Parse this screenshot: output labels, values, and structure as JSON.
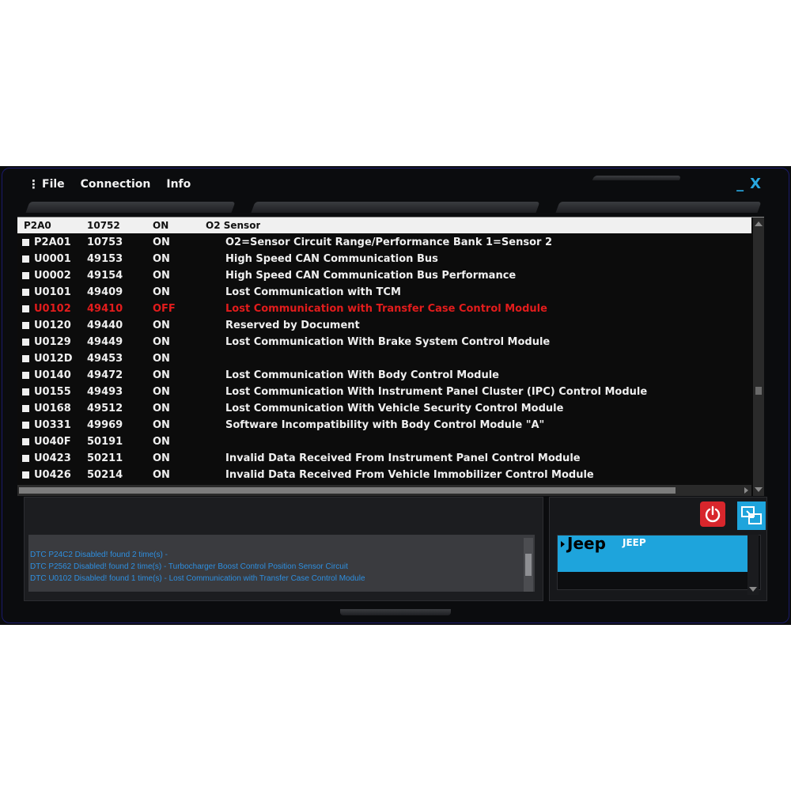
{
  "menu": {
    "grip_icon": "vertical-dots-icon",
    "items": [
      "File",
      "Connection",
      "Info"
    ]
  },
  "window_controls": {
    "minimize": "_",
    "close": "X"
  },
  "table": {
    "header_cells": [
      "P2A0",
      "10752",
      "ON",
      "O2 Sensor"
    ],
    "rows": [
      {
        "code": "P2A01",
        "number": "10753",
        "state": "ON",
        "description": "O2=Sensor Circuit Range/Performance Bank 1=Sensor 2"
      },
      {
        "code": "U0001",
        "number": "49153",
        "state": "ON",
        "description": "High Speed CAN Communication Bus"
      },
      {
        "code": "U0002",
        "number": "49154",
        "state": "ON",
        "description": "High Speed CAN Communication Bus Performance"
      },
      {
        "code": "U0101",
        "number": "49409",
        "state": "ON",
        "description": "Lost Communication with TCM"
      },
      {
        "code": "U0102",
        "number": "49410",
        "state": "OFF",
        "description": "Lost Communication with Transfer Case Control Module"
      },
      {
        "code": "U0120",
        "number": "49440",
        "state": "ON",
        "description": "Reserved by Document"
      },
      {
        "code": "U0129",
        "number": "49449",
        "state": "ON",
        "description": "Lost Communication With Brake System Control Module"
      },
      {
        "code": "U012D",
        "number": "49453",
        "state": "ON",
        "description": ""
      },
      {
        "code": "U0140",
        "number": "49472",
        "state": "ON",
        "description": "Lost Communication With Body Control Module"
      },
      {
        "code": "U0155",
        "number": "49493",
        "state": "ON",
        "description": "Lost Communication With Instrument Panel Cluster (IPC) Control Module"
      },
      {
        "code": "U0168",
        "number": "49512",
        "state": "ON",
        "description": "Lost Communication With Vehicle Security Control Module"
      },
      {
        "code": "U0331",
        "number": "49969",
        "state": "ON",
        "description": "Software Incompatibility with Body Control Module \"A\""
      },
      {
        "code": "U040F",
        "number": "50191",
        "state": "ON",
        "description": ""
      },
      {
        "code": "U0423",
        "number": "50211",
        "state": "ON",
        "description": "Invalid Data Received From Instrument Panel Control Module"
      },
      {
        "code": "U0426",
        "number": "50214",
        "state": "ON",
        "description": "Invalid Data Received From Vehicle Immobilizer Control Module"
      }
    ]
  },
  "log": {
    "lines": [
      "DTC P24C2 Disabled! found 2 time(s) -",
      "DTC P2562 Disabled! found 2 time(s) - Turbocharger Boost Control Position Sensor Circuit",
      "DTC U0102 Disabled! found 1 time(s) - Lost Communication with Transfer Case Control Module"
    ]
  },
  "vehicle": {
    "brand": "Jeep",
    "model": "JEEP"
  },
  "colors": {
    "accent_blue": "#1ea4dc",
    "off_red": "#e21c1c",
    "power_red": "#d8262c",
    "log_text": "#2e8fe0"
  }
}
